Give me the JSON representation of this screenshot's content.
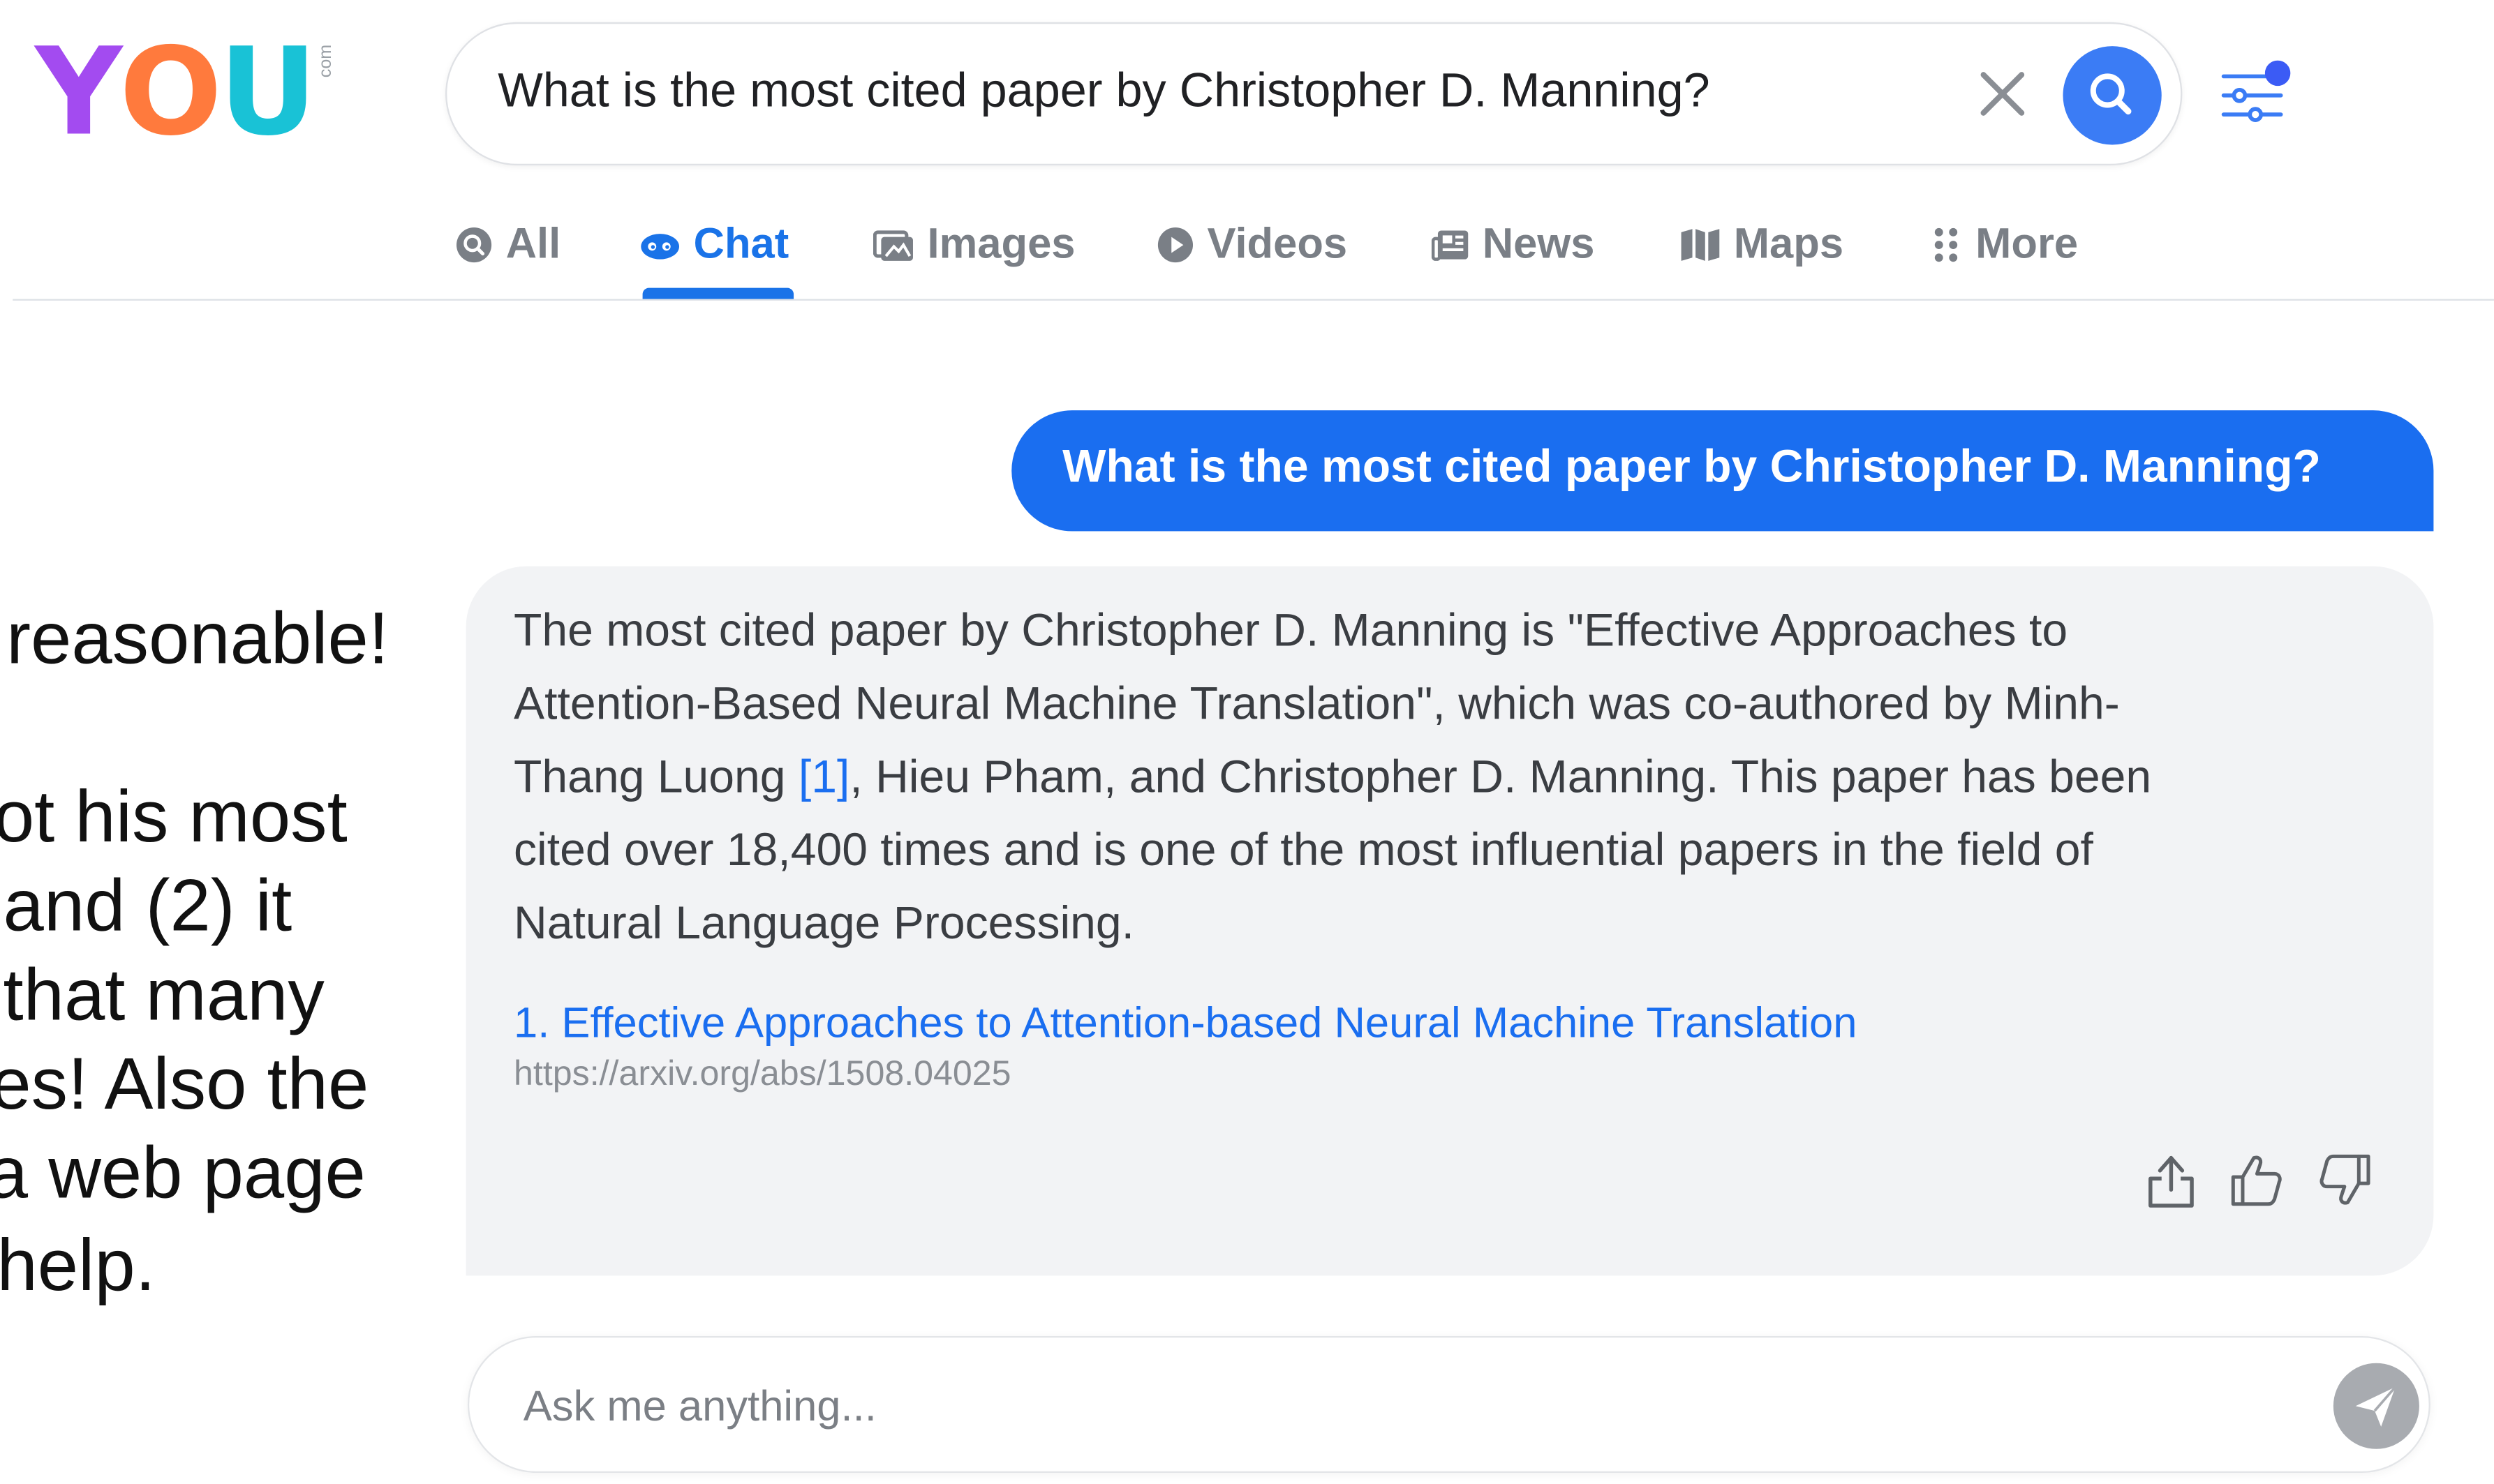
{
  "logo": {
    "letters": [
      "Y",
      "O",
      "U"
    ],
    "suffix": "com"
  },
  "search": {
    "query": "What is the most cited paper by Christopher D. Manning?"
  },
  "tabs": [
    {
      "label": "All",
      "icon": "search-icon"
    },
    {
      "label": "Chat",
      "icon": "chat-icon",
      "active": true
    },
    {
      "label": "Images",
      "icon": "images-icon"
    },
    {
      "label": "Videos",
      "icon": "play-icon"
    },
    {
      "label": "News",
      "icon": "news-icon"
    },
    {
      "label": "Maps",
      "icon": "map-icon"
    },
    {
      "label": "More",
      "icon": "dots-grid-icon"
    }
  ],
  "side_text": {
    "lines": [
      "reasonable!",
      "ot his most",
      " and (2) it",
      " that many",
      "es! Also the",
      "a web page",
      " help."
    ]
  },
  "chat": {
    "user_message": "What is the most cited paper by Christopher D. Manning?",
    "answer": {
      "line1": "The most cited paper by Christopher D. Manning is \"Effective Approaches to",
      "line2": "Attention-Based Neural Machine Translation\", which was co-authored by Minh-",
      "line3_pre": "Thang Luong ",
      "line3_cite": "[1]",
      "line3_post": ", Hieu Pham, and Christopher D. Manning. This paper has been",
      "line4": "cited over 18,400 times and is one of the most influential papers in the field of",
      "line5": "Natural Language Processing."
    },
    "reference": {
      "title": "1. Effective Approaches to Attention-based Neural Machine Translation",
      "url": "https://arxiv.org/abs/1508.04025"
    },
    "actions": [
      "share-icon",
      "thumbs-up-icon",
      "thumbs-down-icon"
    ]
  },
  "ask": {
    "placeholder": "Ask me anything..."
  },
  "colors": {
    "accent": "#1a6ef0",
    "search_button": "#3b7cf5",
    "tab_inactive": "#7a7f86",
    "answer_bg": "#f2f3f5"
  }
}
